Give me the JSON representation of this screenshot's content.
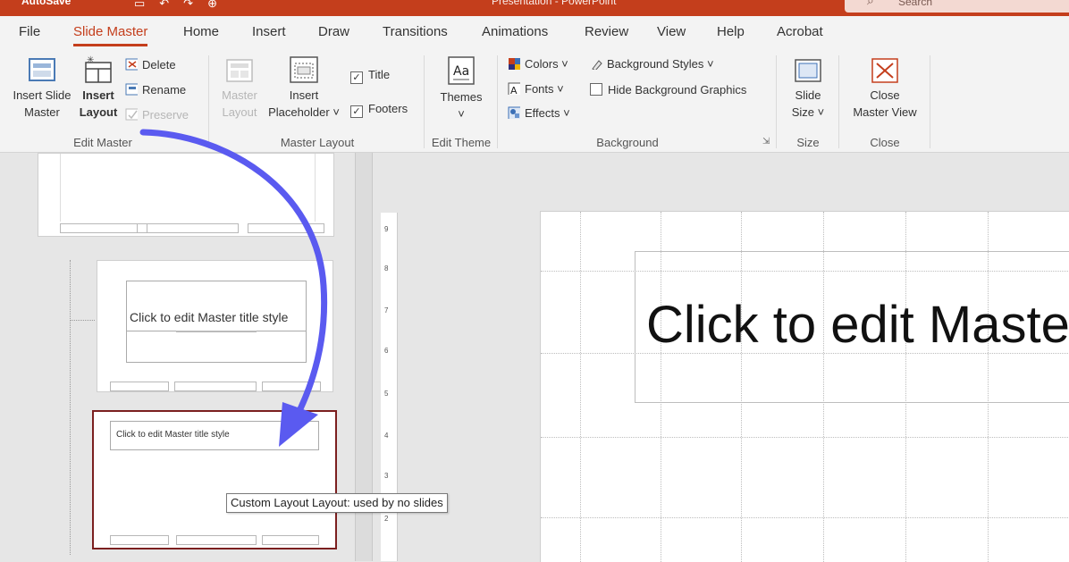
{
  "titlebar": {
    "autosave": "AutoSave",
    "title": "Presentation - PowerPoint",
    "search_placeholder": "Search"
  },
  "tabs": [
    "File",
    "Slide Master",
    "Home",
    "Insert",
    "Draw",
    "Transitions",
    "Animations",
    "Review",
    "View",
    "Help",
    "Acrobat"
  ],
  "active_tab": "Slide Master",
  "ribbon": {
    "edit_master": {
      "label": "Edit Master",
      "insert_slide_master": [
        "Insert Slide",
        "Master"
      ],
      "insert_layout": [
        "Insert",
        "Layout"
      ],
      "delete": "Delete",
      "rename": "Rename",
      "preserve": "Preserve"
    },
    "master_layout": {
      "label": "Master Layout",
      "master_layout_btn": [
        "Master",
        "Layout"
      ],
      "insert_placeholder": [
        "Insert",
        "Placeholder ˅"
      ],
      "title": "Title",
      "footers": "Footers"
    },
    "edit_theme": {
      "label": "Edit Theme",
      "themes": "Themes",
      "themes_icon_text": "Aa"
    },
    "background": {
      "label": "Background",
      "colors": "Colors ˅",
      "fonts": "Fonts ˅",
      "effects": "Effects ˅",
      "background_styles": "Background Styles ˅",
      "hide_background_graphics": "Hide Background Graphics"
    },
    "size": {
      "label": "Size",
      "slide_size": [
        "Slide",
        "Size ˅"
      ]
    },
    "close": {
      "label": "Close",
      "close_master_view": [
        "Close",
        "Master View"
      ]
    }
  },
  "thumbnails": {
    "thumb2_title": "Click to edit Master title style",
    "thumb3_title": "Click to edit Master title style"
  },
  "tooltip": "Custom Layout Layout: used by no slides",
  "ruler_ticks": [
    "9",
    "8",
    "7",
    "6",
    "5",
    "4",
    "3",
    "2"
  ],
  "slide": {
    "title_text": "Click to edit Master title style"
  },
  "colors": {
    "accent": "#c43e1c",
    "arrow": "#5a5af0",
    "selected_thumb": "#7b1f1f"
  }
}
